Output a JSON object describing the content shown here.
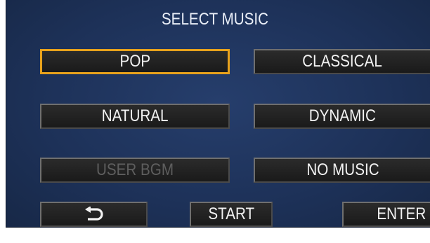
{
  "screen": {
    "title": "SELECT MUSIC"
  },
  "options": [
    {
      "label": "POP",
      "state": "selected"
    },
    {
      "label": "CLASSICAL",
      "state": "normal"
    },
    {
      "label": "NATURAL",
      "state": "normal"
    },
    {
      "label": "DYNAMIC",
      "state": "normal"
    },
    {
      "label": "USER BGM",
      "state": "disabled"
    },
    {
      "label": "NO MUSIC",
      "state": "normal"
    }
  ],
  "footer": {
    "return_icon": "return-arrow-icon",
    "start_label": "START",
    "enter_label": "ENTER"
  },
  "colors": {
    "background": "#1d3158",
    "button_fill": "#1f1f1f",
    "button_border": "#6f6f6f",
    "selection": "#e8a21c",
    "text": "#f2f2f2",
    "disabled_text": "#5e5e5e"
  }
}
